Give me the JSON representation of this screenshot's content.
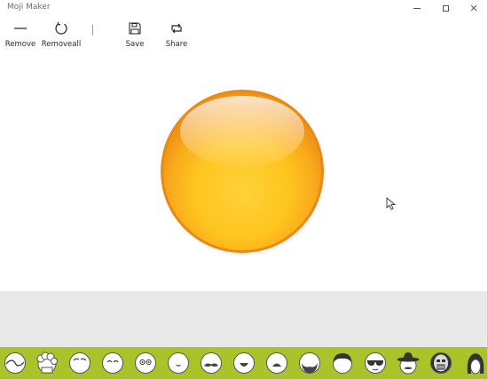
{
  "window": {
    "title": "Moji Maker"
  },
  "toolbar": {
    "items": [
      {
        "label": "Remove",
        "icon": "minus-icon"
      },
      {
        "label": "Removeall",
        "icon": "refresh-icon"
      },
      {
        "label": "Save",
        "icon": "floppy-disk-icon"
      },
      {
        "label": "Share",
        "icon": "share-icon"
      }
    ]
  },
  "canvas": {
    "face": "yellow-face-base",
    "face_colors": {
      "light": "#ffd54a",
      "dark": "#f3a91c",
      "rim": "#ef9a17"
    }
  },
  "palette": {
    "background": "#a8c42a",
    "items": [
      "face-shape-icon",
      "hair-curly-icon",
      "eyebrows-icon",
      "eyes-closed-icon",
      "eyes-round-icon",
      "mouth-small-icon",
      "mustache-icon",
      "mouth-smile-icon",
      "nose-mustache-icon",
      "beard-icon",
      "hair-short-icon",
      "sunglasses-icon",
      "sombrero-icon",
      "mask-icon",
      "hair-long-icon"
    ]
  }
}
